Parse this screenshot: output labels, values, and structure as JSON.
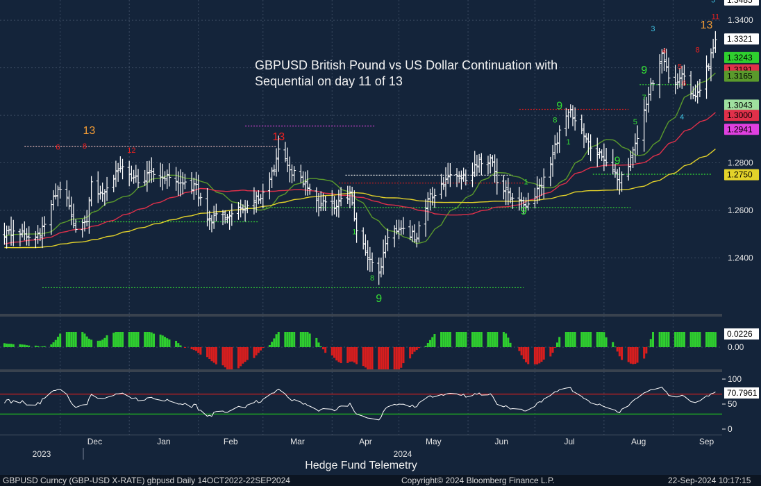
{
  "title_lines": [
    "GBPUSD British Pound vs US Dollar Continuation with",
    "Sequential on day 11 of 13"
  ],
  "footer": {
    "caption": "Hedge Fund Telemetry",
    "security": "GBPUSD Curncy (GBP-USD X-RATE) gbpusd  Daily 14OCT2022-22SEP2024",
    "copyright": "Copyright© 2024 Bloomberg Finance L.P.",
    "timestamp": "22-Sep-2024  10:17:15"
  },
  "colors": {
    "background": "#14243a",
    "bar": "#ffffff",
    "sma_short": "#5a9a2c",
    "sma_mid": "#e0304a",
    "sma_long": "#e3d22a",
    "positive": "#2fcf2f",
    "negative": "#d81e1e",
    "setup_green": "#35e035",
    "setup_red": "#f02020",
    "countdown_orange": "#f09a35",
    "rsi_line": "#ffffff",
    "rsi_upper": "#cc2020",
    "rsi_lower": "#20c020"
  },
  "chart_data": [
    {
      "type": "ohlc",
      "name": "price",
      "y_ticks": [
        1.24,
        1.26,
        1.28,
        1.3,
        1.32,
        1.34
      ],
      "y_tick_labels": [
        "1.2400",
        "1.2600",
        "1.2800",
        "",
        "",
        "1.3400"
      ],
      "ylim": [
        1.2165,
        1.3485
      ],
      "x_months": [
        "Dec",
        "Jan",
        "Feb",
        "Mar",
        "Apr",
        "May",
        "Jun",
        "Jul",
        "Aug",
        "Sep"
      ],
      "x_years": [
        "2023",
        "2024"
      ],
      "anchor_closes": [
        [
          "2023-11-22",
          1.25
        ],
        [
          "2023-11-27",
          1.262
        ],
        [
          "2023-12-01",
          1.27
        ],
        [
          "2023-12-04",
          1.265
        ],
        [
          "2023-12-08",
          1.252
        ],
        [
          "2023-12-13",
          1.256
        ],
        [
          "2023-12-15",
          1.272
        ],
        [
          "2023-12-20",
          1.266
        ],
        [
          "2023-12-28",
          1.279
        ],
        [
          "2024-01-05",
          1.272
        ],
        [
          "2024-01-12",
          1.276
        ],
        [
          "2024-01-22",
          1.272
        ],
        [
          "2024-01-31",
          1.27
        ],
        [
          "2024-02-05",
          1.256
        ],
        [
          "2024-02-14",
          1.258
        ],
        [
          "2024-02-20",
          1.26
        ],
        [
          "2024-02-28",
          1.265
        ],
        [
          "2024-03-04",
          1.272
        ],
        [
          "2024-03-08",
          1.285
        ],
        [
          "2024-03-14",
          1.276
        ],
        [
          "2024-03-20",
          1.272
        ],
        [
          "2024-03-25",
          1.263
        ],
        [
          "2024-04-02",
          1.262
        ],
        [
          "2024-04-09",
          1.267
        ],
        [
          "2024-04-12",
          1.252
        ],
        [
          "2024-04-16",
          1.244
        ],
        [
          "2024-04-19",
          1.237
        ],
        [
          "2024-04-22",
          1.232
        ],
        [
          "2024-04-26",
          1.249
        ],
        [
          "2024-05-01",
          1.252
        ],
        [
          "2024-05-09",
          1.249
        ],
        [
          "2024-05-15",
          1.266
        ],
        [
          "2024-05-24",
          1.275
        ],
        [
          "2024-05-31",
          1.274
        ],
        [
          "2024-06-06",
          1.28
        ],
        [
          "2024-06-12",
          1.281
        ],
        [
          "2024-06-14",
          1.272
        ],
        [
          "2024-06-21",
          1.265
        ],
        [
          "2024-06-27",
          1.263
        ],
        [
          "2024-07-02",
          1.268
        ],
        [
          "2024-07-08",
          1.28
        ],
        [
          "2024-07-12",
          1.293
        ],
        [
          "2024-07-17",
          1.302
        ],
        [
          "2024-07-22",
          1.292
        ],
        [
          "2024-07-26",
          1.287
        ],
        [
          "2024-08-01",
          1.281
        ],
        [
          "2024-08-05",
          1.277
        ],
        [
          "2024-08-08",
          1.272
        ],
        [
          "2024-08-12",
          1.28
        ],
        [
          "2024-08-16",
          1.29
        ],
        [
          "2024-08-21",
          1.309
        ],
        [
          "2024-08-27",
          1.326
        ],
        [
          "2024-08-30",
          1.316
        ],
        [
          "2024-09-03",
          1.313
        ],
        [
          "2024-09-06",
          1.318
        ],
        [
          "2024-09-10",
          1.307
        ],
        [
          "2024-09-13",
          1.312
        ],
        [
          "2024-09-17",
          1.322
        ],
        [
          "2024-09-20",
          1.332
        ]
      ],
      "right_labels": [
        {
          "text": "1.3485",
          "value": 1.3485,
          "color": "#ffffff"
        },
        {
          "text": "1.3400",
          "value": 1.34,
          "color": "plain"
        },
        {
          "text": "1.3321",
          "value": 1.3321,
          "color": "#ffffff"
        },
        {
          "text": "1.3243",
          "value": 1.3243,
          "color": "#2fcf2f"
        },
        {
          "text": "1.3191",
          "value": 1.3191,
          "color": "#e0304a"
        },
        {
          "text": "1.3165",
          "value": 1.3165,
          "color": "#5a9a2c"
        },
        {
          "text": "1.3043",
          "value": 1.3043,
          "color": "#9fe09f"
        },
        {
          "text": "1.3000",
          "value": 1.3,
          "color": "#e0304a"
        },
        {
          "text": "1.2941",
          "value": 1.2941,
          "color": "#e040e0"
        },
        {
          "text": "1.2750",
          "value": 1.275,
          "color": "#e3d22a"
        }
      ],
      "series": [
        {
          "name": "",
          "kind": "sma",
          "period": 20
        },
        {
          "name": "",
          "kind": "sma",
          "period": 50
        },
        {
          "name": "",
          "kind": "sma",
          "period": 100
        }
      ],
      "sequential_annotations": [
        {
          "text": "13",
          "date": "2023-12-14",
          "value": 1.2922,
          "color": "#f09a35"
        },
        {
          "text": "13",
          "date": "2024-03-08",
          "value": 1.2895,
          "color": "#f02020"
        },
        {
          "text": "9",
          "date": "2024-04-22",
          "value": 1.2215,
          "color": "#35e035"
        },
        {
          "text": "9",
          "date": "2024-06-26",
          "value": 1.2582,
          "color": "#35e035"
        },
        {
          "text": "9",
          "date": "2024-07-12",
          "value": 1.3025,
          "color": "#35e035"
        },
        {
          "text": "9",
          "date": "2024-08-07",
          "value": 1.2795,
          "color": "#35e035"
        },
        {
          "text": "9",
          "date": "2024-08-19",
          "value": 1.3175,
          "color": "#35e035"
        },
        {
          "text": "13",
          "date": "2024-09-16",
          "value": 1.3365,
          "color": "#f09a35"
        },
        {
          "text": "3",
          "date": "2024-08-23",
          "value": 1.3353,
          "color": "#3fc0e0"
        },
        {
          "text": "5",
          "date": "2024-09-19",
          "value": 1.3475,
          "color": "#3fc0e0"
        },
        {
          "text": "11",
          "date": "2024-09-20",
          "value": 1.3405,
          "color": "#f02020"
        },
        {
          "text": "4",
          "date": "2024-08-28",
          "value": 1.326,
          "color": "#f02020"
        },
        {
          "text": "5",
          "date": "2024-09-04",
          "value": 1.3195,
          "color": "#f02020"
        },
        {
          "text": "8",
          "date": "2024-09-12",
          "value": 1.3265,
          "color": "#f02020"
        },
        {
          "text": "6",
          "date": "2024-09-06",
          "value": 1.3125,
          "color": "#f02020"
        },
        {
          "text": "4",
          "date": "2024-09-05",
          "value": 1.2982,
          "color": "#3fc0e0"
        },
        {
          "text": "7",
          "date": "2024-08-19",
          "value": 1.3065,
          "color": "#35e035"
        },
        {
          "text": "5",
          "date": "2024-08-15",
          "value": 1.2962,
          "color": "#35e035"
        },
        {
          "text": "1",
          "date": "2024-06-27",
          "value": 1.271,
          "color": "#35e035"
        },
        {
          "text": "1",
          "date": "2024-07-16",
          "value": 1.2878,
          "color": "#35e035"
        },
        {
          "text": "8",
          "date": "2024-07-10",
          "value": 1.297,
          "color": "#35e035"
        },
        {
          "text": "1",
          "date": "2024-04-11",
          "value": 1.25,
          "color": "#35e035"
        },
        {
          "text": "8",
          "date": "2024-04-19",
          "value": 1.2305,
          "color": "#35e035"
        },
        {
          "text": "6",
          "date": "2023-11-30",
          "value": 1.2855,
          "color": "#f02020"
        },
        {
          "text": "8",
          "date": "2023-12-12",
          "value": 1.286,
          "color": "#f02020"
        },
        {
          "text": "12",
          "date": "2024-01-02",
          "value": 1.2842,
          "color": "#f02020"
        }
      ],
      "trend_levels": [
        {
          "from": "2023-11-15",
          "to": "2024-03-07",
          "value": 1.287,
          "color": "#e6b8b8"
        },
        {
          "from": "2024-02-22",
          "to": "2024-04-20",
          "value": 1.2955,
          "color": "#d040d0"
        },
        {
          "from": "2024-04-07",
          "to": "2024-06-21",
          "value": 1.2748,
          "color": "#dddddd"
        },
        {
          "from": "2024-04-04",
          "to": "2024-06-26",
          "value": 1.2715,
          "color": "#d81e1e"
        },
        {
          "from": "2024-06-24",
          "to": "2024-08-12",
          "value": 1.3025,
          "color": "#d81e1e"
        },
        {
          "from": "2024-07-27",
          "to": "2024-09-18",
          "value": 1.2752,
          "color": "#35e035"
        },
        {
          "from": "2023-11-23",
          "to": "2024-06-26",
          "value": 1.2275,
          "color": "#35e035"
        },
        {
          "from": "2023-12-08",
          "to": "2024-02-28",
          "value": 1.2552,
          "color": "#35e035"
        },
        {
          "from": "2024-03-01",
          "to": "2024-08-13",
          "value": 1.2612,
          "color": "#35e035"
        },
        {
          "from": "2024-08-17",
          "to": "2024-09-09",
          "value": 1.3129,
          "color": "#35e035"
        }
      ]
    },
    {
      "type": "bar",
      "name": "oscillator",
      "y_ticks": [
        0.0
      ],
      "y_tick_labels": [
        "0.00"
      ],
      "last_value": 0.0226,
      "last_label": "0.0226"
    },
    {
      "type": "line",
      "name": "rsi",
      "y_ticks": [
        0,
        50,
        100
      ],
      "y_tick_labels": [
        "0",
        "50",
        "100"
      ],
      "ylim": [
        0,
        100
      ],
      "bands": [
        70,
        30
      ],
      "last_value": 70.7961,
      "last_label": "70.7961"
    }
  ]
}
